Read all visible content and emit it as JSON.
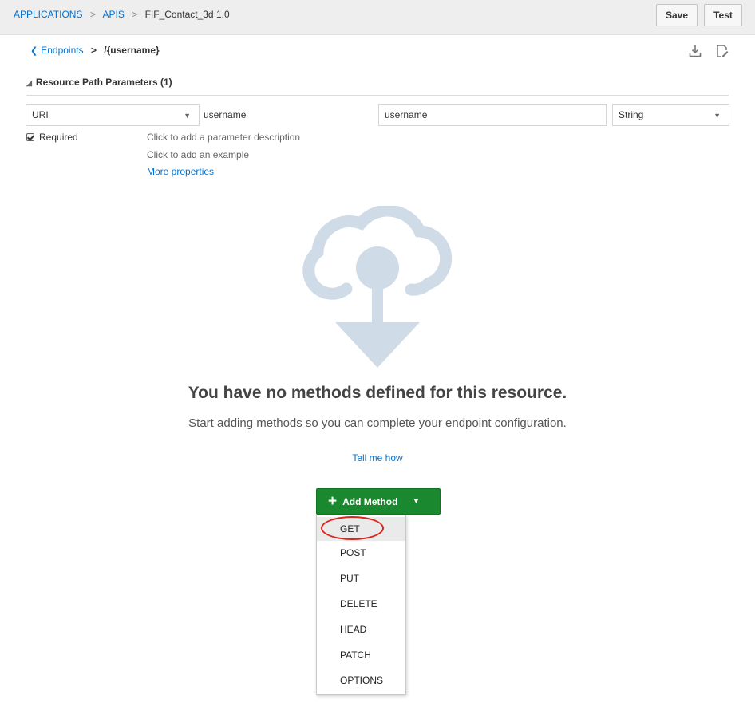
{
  "breadcrumbs": [
    {
      "label": "APPLICATIONS",
      "link": true
    },
    {
      "label": "APIS",
      "link": true
    },
    {
      "label": "FIF_Contact_3d  1.0",
      "link": false
    }
  ],
  "breadcrumb_separator": ">",
  "toolbar": {
    "save_label": "Save",
    "test_label": "Test"
  },
  "subnav": {
    "back_label": "Endpoints",
    "separator": ">",
    "current_path": "/{username}"
  },
  "section": {
    "title": "Resource Path Parameters (1)"
  },
  "parameter": {
    "location_value": "URI",
    "name_label": "username",
    "display_name_value": "username",
    "type_value": "String",
    "required_label": "Required",
    "required_checked": true,
    "description_hint": "Click to add a parameter description",
    "example_hint": "Click to add an example",
    "more_properties_label": "More properties"
  },
  "empty_state": {
    "title": "You have no methods defined for this resource.",
    "subtitle": "Start adding methods so you can complete your endpoint configuration.",
    "help_link": "Tell me how"
  },
  "add_method": {
    "label": "Add Method",
    "menu_items": [
      "GET",
      "POST",
      "PUT",
      "DELETE",
      "HEAD",
      "PATCH",
      "OPTIONS"
    ],
    "selected_item": "GET"
  },
  "colors": {
    "link": "#0572ce",
    "accent_green": "#19882e",
    "highlight_red": "#d8261c",
    "illustration": "#cfdbe6",
    "top_bar": "#eeeeee"
  },
  "icons": [
    "chevron-left-icon",
    "download-icon",
    "edit-icon",
    "triangle-collapse-icon",
    "checkbox-icon",
    "caret-down-icon",
    "cloud-download-icon",
    "plus-icon"
  ]
}
